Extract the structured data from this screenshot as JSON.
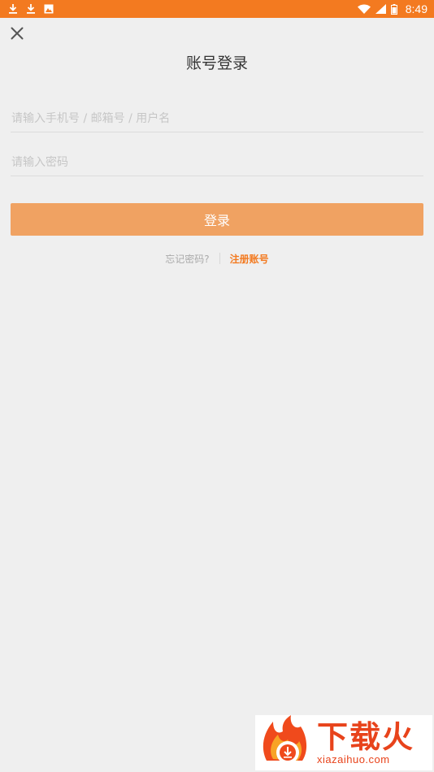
{
  "status_bar": {
    "time": "8:49",
    "left_icons": [
      "download-icon",
      "download-icon",
      "image-icon"
    ],
    "right_icons": [
      "wifi-icon",
      "signal-icon",
      "battery-icon"
    ],
    "background": "#f37a20"
  },
  "header": {
    "title": "账号登录",
    "close_icon": "close-icon"
  },
  "form": {
    "account_placeholder": "请输入手机号 / 邮箱号 / 用户名",
    "password_placeholder": "请输入密码",
    "login_label": "登录",
    "login_color": "#f0a262"
  },
  "links": {
    "forgot_label": "忘记密码?",
    "register_label": "注册账号",
    "register_color": "#f37a20"
  },
  "watermark": {
    "title": "下载火",
    "url": "xiazaihuo.com"
  }
}
